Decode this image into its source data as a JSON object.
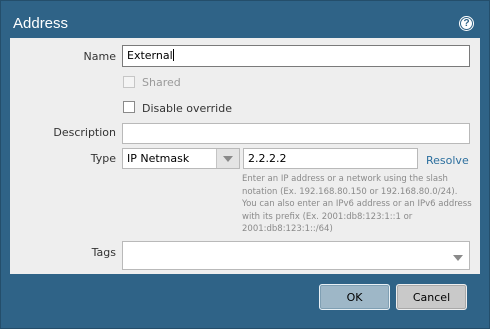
{
  "dialog": {
    "title": "Address",
    "help_icon": "question-circle-icon"
  },
  "form": {
    "name_label": "Name",
    "name_value": "External",
    "shared_label": "Shared",
    "shared_checked": false,
    "disable_override_label": "Disable override",
    "disable_override_checked": false,
    "description_label": "Description",
    "description_value": "",
    "type_label": "Type",
    "type_selected": "IP Netmask",
    "type_value": "2.2.2.2",
    "resolve_label": "Resolve",
    "type_help": "Enter an IP address or a network using the slash notation (Ex. 192.168.80.150 or 192.168.80.0/24). You can also enter an IPv6 address or an IPv6 address with its prefix (Ex. 2001:db8:123:1::1 or 2001:db8:123:1::/64)",
    "tags_label": "Tags",
    "tags_value": ""
  },
  "buttons": {
    "ok_label": "OK",
    "cancel_label": "Cancel"
  },
  "colors": {
    "frame": "#2f6387",
    "panel": "#eeeeee",
    "link": "#2c6f9e"
  }
}
